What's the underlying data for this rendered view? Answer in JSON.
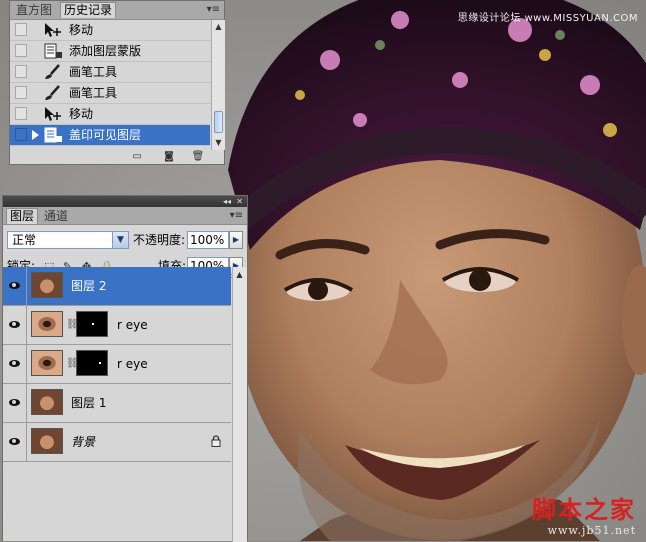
{
  "history": {
    "tabs": [
      {
        "label": "直方图",
        "active": false
      },
      {
        "label": "历史记录",
        "active": true
      }
    ],
    "items": [
      {
        "label": "移动",
        "icon": "move-tool-icon",
        "selected": false
      },
      {
        "label": "添加图层蒙版",
        "icon": "history-state-icon",
        "selected": false
      },
      {
        "label": "画笔工具",
        "icon": "brush-icon",
        "selected": false
      },
      {
        "label": "画笔工具",
        "icon": "brush-icon",
        "selected": false
      },
      {
        "label": "移动",
        "icon": "move-tool-icon",
        "selected": false
      },
      {
        "label": "盖印可见图层",
        "icon": "history-state-icon",
        "selected": true
      }
    ],
    "scroll_position": 0.85
  },
  "layers": {
    "tabs": [
      {
        "label": "图层",
        "active": true
      },
      {
        "label": "通道",
        "active": false
      }
    ],
    "blend_mode": "正常",
    "opacity_label": "不透明度:",
    "opacity_value": "100%",
    "lock_label": "锁定:",
    "fill_label": "填充:",
    "fill_value": "100%",
    "rows": [
      {
        "name": "图层 2",
        "visible": true,
        "selected": true,
        "thumb": "face",
        "has_mask": false,
        "locked": false
      },
      {
        "name": "r eye",
        "visible": true,
        "selected": false,
        "thumb": "eye",
        "has_mask": true,
        "locked": false
      },
      {
        "name": "r eye",
        "visible": true,
        "selected": false,
        "thumb": "eye",
        "has_mask": true,
        "locked": false
      },
      {
        "name": "图层 1",
        "visible": true,
        "selected": false,
        "thumb": "face",
        "has_mask": false,
        "locked": false
      },
      {
        "name": "背景",
        "visible": true,
        "selected": false,
        "thumb": "face",
        "has_mask": false,
        "locked": true,
        "italic": true
      }
    ]
  },
  "watermarks": {
    "top": "思缘设计论坛 www.MISSYUAN.COM",
    "bottom_brand": "脚本之家",
    "bottom_url": "www.jb51.net"
  },
  "colors": {
    "selection": "#3a72c6",
    "panel_bg": "#d6d6d6",
    "titlebar": "#3c3c3c"
  }
}
